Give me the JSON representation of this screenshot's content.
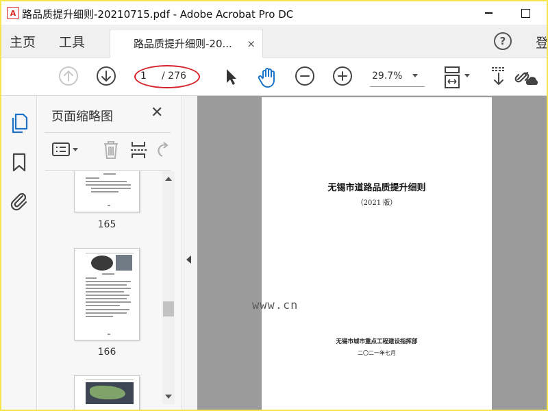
{
  "window": {
    "title": "路品质提升细则-20210715.pdf - Adobe Acrobat Pro DC",
    "app_icon_label": "A"
  },
  "tabs": {
    "home": "主页",
    "tools": "工具",
    "document": "路品质提升细则-20...",
    "close_glyph": "×",
    "help_glyph": "?",
    "login": "登"
  },
  "toolbar": {
    "current_page": "1",
    "total_pages": "/ 276",
    "zoom": "29.7%"
  },
  "thumbnail_panel": {
    "title": "页面缩略图",
    "close_glyph": "✕",
    "pages": [
      {
        "label": "165"
      },
      {
        "label": "166"
      }
    ]
  },
  "document": {
    "title": "无锡市道路品质提升细则",
    "edition": "（2021 版）",
    "organization": "无锡市城市重点工程建设指挥部",
    "date": "二〇二一年七月"
  },
  "watermark": "www.cn",
  "colors": {
    "highlight_ellipse": "#d4222a",
    "hand_tool": "#1a73c8",
    "border_yellow": "#f4e64a"
  }
}
